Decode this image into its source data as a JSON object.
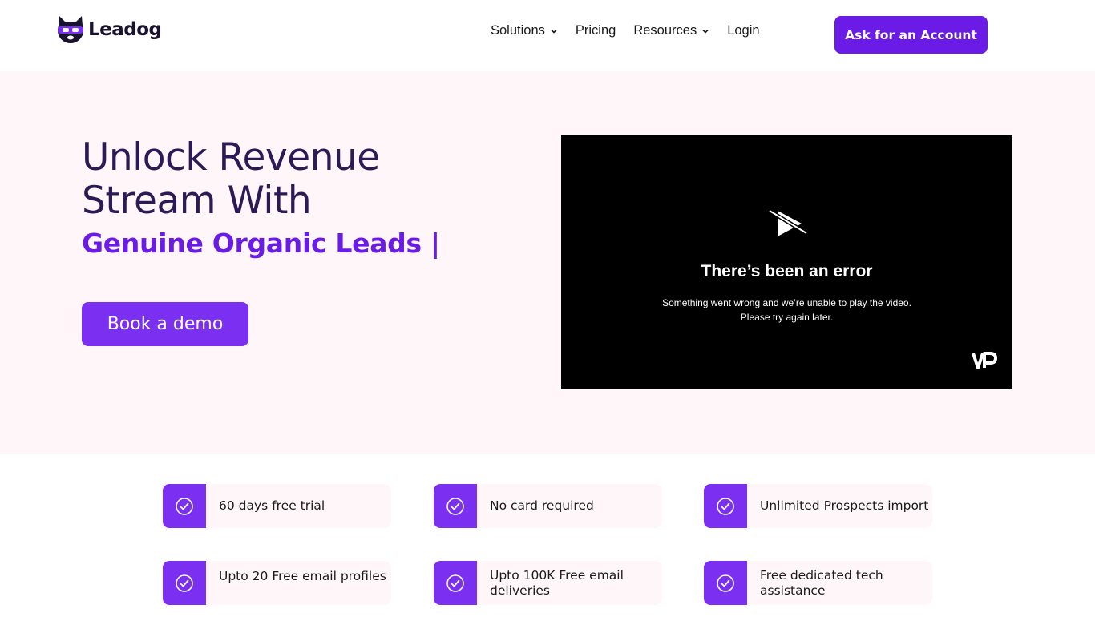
{
  "brand": {
    "name": "Leadog",
    "primary_color": "#6a1be5",
    "heading_color": "#2a1a55",
    "hero_bg": "#fff6f9"
  },
  "nav": {
    "items": [
      {
        "label": "Solutions",
        "dropdown": true
      },
      {
        "label": "Pricing",
        "dropdown": false
      },
      {
        "label": "Resources",
        "dropdown": true
      },
      {
        "label": "Login",
        "dropdown": false
      }
    ],
    "cta_label": "Ask for an Account"
  },
  "hero": {
    "title_line1": "Unlock Revenue",
    "title_line2": "Stream With",
    "subtitle": "Genuine Organic Leads |",
    "demo_label": "Book a demo"
  },
  "video": {
    "error_title": "There’s been an error",
    "error_line1": "Something went wrong and we’re unable to play the video.",
    "error_line2": "Please try again later."
  },
  "features": [
    {
      "text": "60 days free trial"
    },
    {
      "text": "No card required"
    },
    {
      "text": "Unlimited Prospects import"
    },
    {
      "text": "Upto 20 Free email profiles"
    },
    {
      "text": "Upto 100K Free email deliveries"
    },
    {
      "text": "Free dedicated tech assistance"
    }
  ]
}
